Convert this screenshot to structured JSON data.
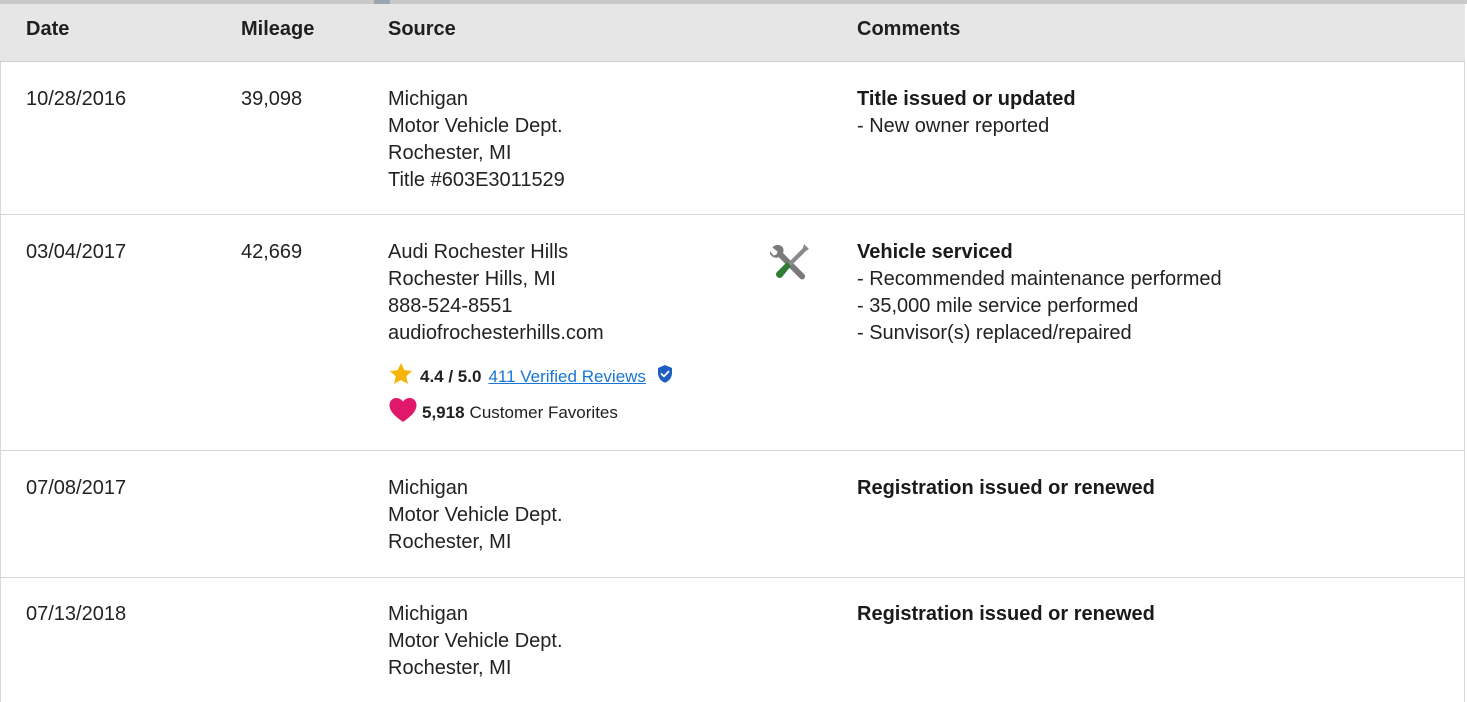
{
  "header": {
    "date": "Date",
    "mileage": "Mileage",
    "source": "Source",
    "comments": "Comments"
  },
  "rows": [
    {
      "date": "10/28/2016",
      "mileage": "39,098",
      "source": [
        "Michigan",
        "Motor Vehicle Dept.",
        "Rochester, MI",
        "Title #603E3011529"
      ],
      "comment_title": "Title issued or updated",
      "comments": [
        "- New owner reported"
      ]
    },
    {
      "date": "03/04/2017",
      "mileage": "42,669",
      "source": [
        "Audi Rochester Hills",
        "Rochester Hills, MI",
        "888-524-8551",
        "audiofrochesterhills.com"
      ],
      "rating": "4.4 / 5.0",
      "reviews_link": "411 Verified Reviews",
      "favorites_count": "5,918",
      "favorites_label": "Customer Favorites",
      "service_icon": "wrench-screwdriver-icon",
      "comment_title": "Vehicle serviced",
      "comments": [
        "- Recommended maintenance performed",
        "- 35,000 mile service performed",
        "- Sunvisor(s) replaced/repaired"
      ]
    },
    {
      "date": "07/08/2017",
      "mileage": "",
      "source": [
        "Michigan",
        "Motor Vehicle Dept.",
        "Rochester, MI"
      ],
      "comment_title": "Registration issued or renewed",
      "comments": []
    },
    {
      "date": "07/13/2018",
      "mileage": "",
      "source": [
        "Michigan",
        "Motor Vehicle Dept.",
        "Rochester, MI"
      ],
      "comment_title": "Registration issued or renewed",
      "comments": []
    }
  ],
  "colors": {
    "header_bg": "#e6e6e6",
    "link": "#1976d2",
    "star": "#f5b50a",
    "heart": "#e0186c",
    "shield": "#1e5fc1",
    "wrench_handle": "#2e7d32"
  }
}
